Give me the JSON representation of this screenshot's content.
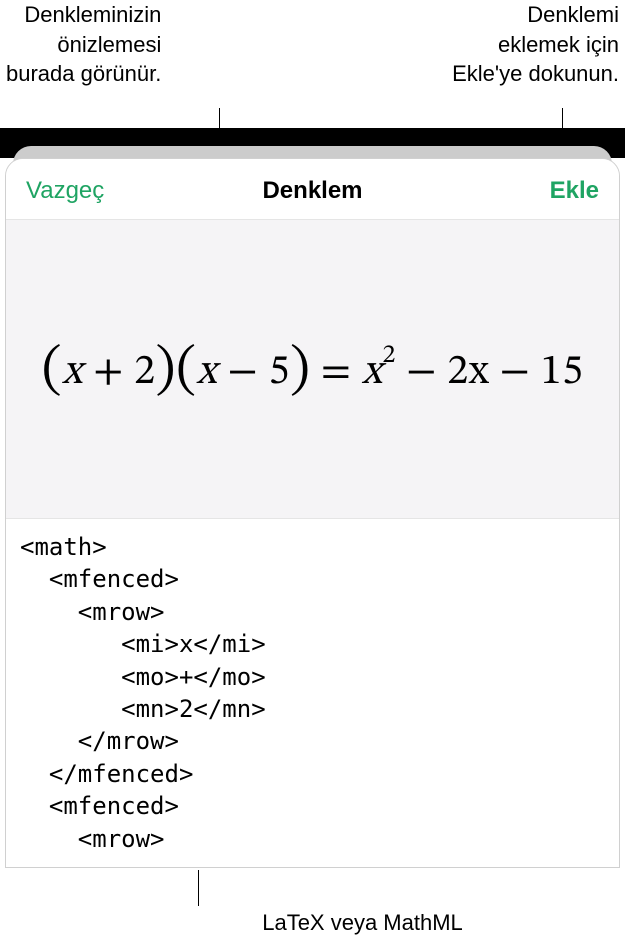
{
  "callouts": {
    "preview": "Denkleminizin\nönizlemesi\nburada görünür.",
    "insert": "Denklemi\neklemek için\nEkle'ye dokunun.",
    "input": "LaTeX veya MathML"
  },
  "modal": {
    "cancel": "Vazgeç",
    "title": "Denklem",
    "insert": "Ekle"
  },
  "equation": {
    "lparen1": "(",
    "term1a": "x",
    "op1": " + ",
    "term1b": "2",
    "rparen1": ")",
    "lparen2": "(",
    "term2a": "x",
    "op2": " − ",
    "term2b": "5",
    "rparen2": ")",
    "eq": " = ",
    "rhs_x": "x",
    "rhs_exp": "2",
    "rhs_rest": " − 2x − 15"
  },
  "code": "<math>\n  <mfenced>\n    <mrow>\n       <mi>x</mi>\n       <mo>+</mo>\n       <mn>2</mn>\n    </mrow>\n  </mfenced>\n  <mfenced>\n    <mrow>"
}
